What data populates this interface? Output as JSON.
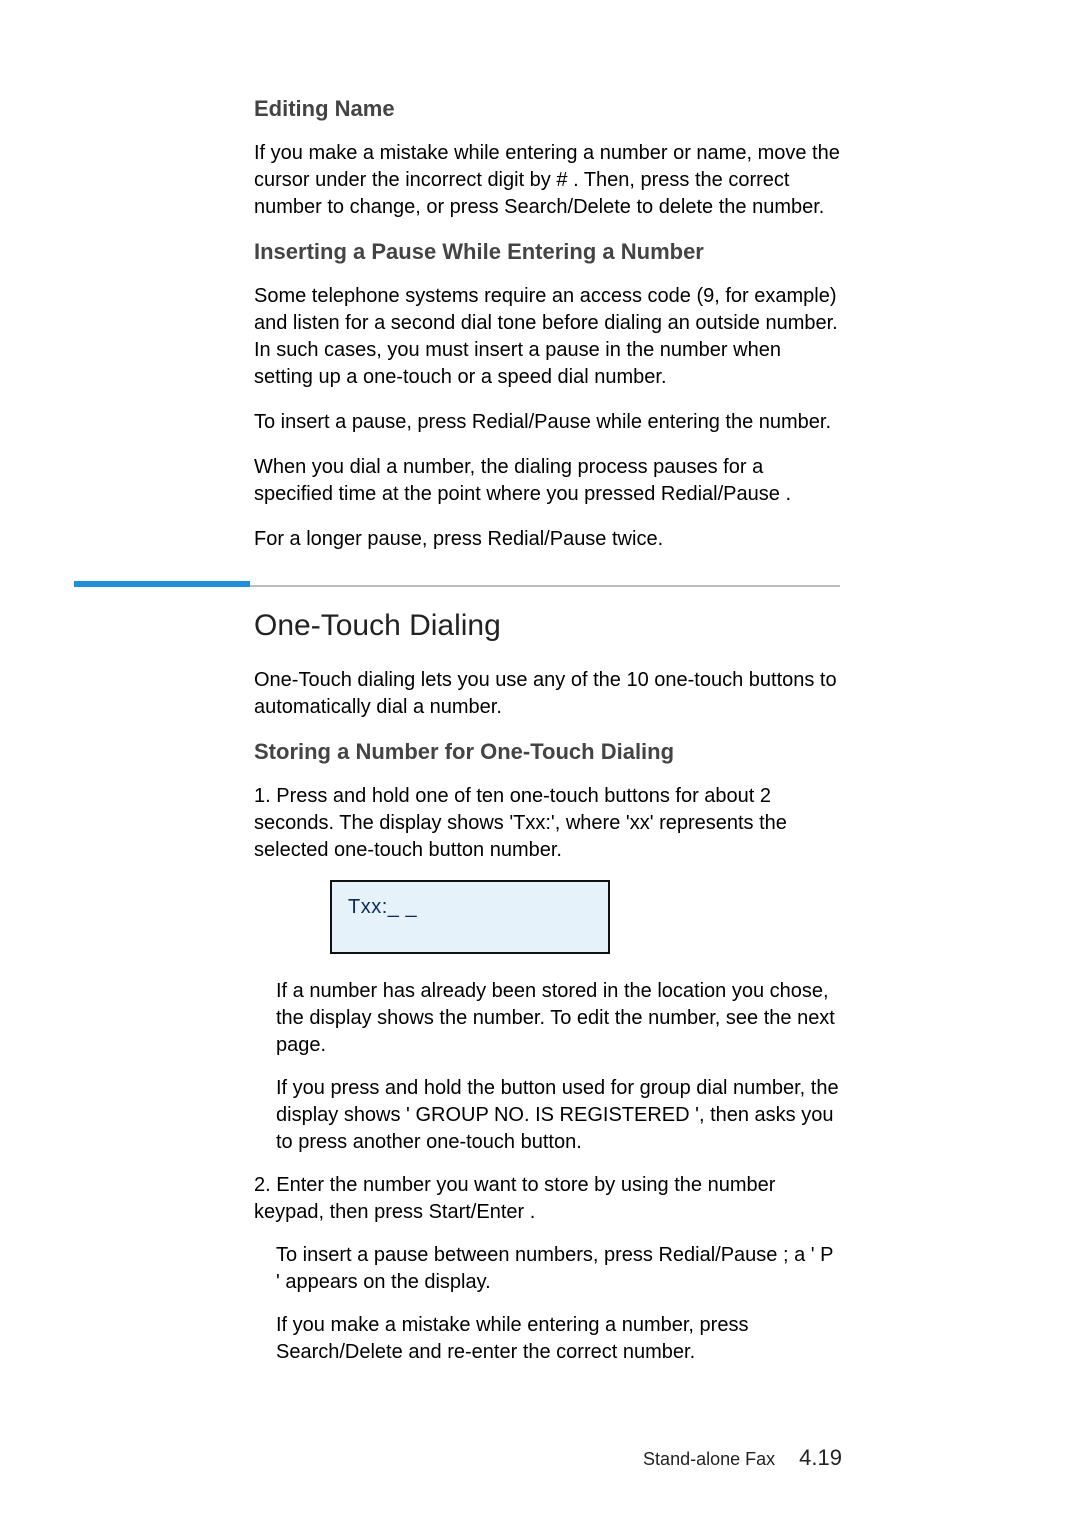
{
  "s1": {
    "title": "Editing Name",
    "p1a": "If you make a mistake while entering a number or name, move the cursor under the incorrect digit by ",
    "p1b": "#",
    "p1c": " . Then, press the correct number to change, or press ",
    "p1d": "Search/Delete",
    "p1e": " to delete the number."
  },
  "s2": {
    "title": "Inserting a Pause While Entering a Number",
    "p1": "Some telephone systems require an access code (9, for example) and listen for a second dial tone before dialing an outside number. In such cases, you must insert a pause in the number when setting up a one-touch or a speed dial number.",
    "p2a": "To insert a pause, press ",
    "p2b": "Redial/Pause",
    "p2c": " while entering the number.",
    "p3a": "When you dial a number, the dialing process pauses for a specified time at the point where you pressed ",
    "p3b": "Redial/Pause",
    "p3c": " .",
    "p4a": "For a longer pause, press ",
    "p4b": "Redial/Pause",
    "p4c": " twice."
  },
  "s3": {
    "title": "One-Touch Dialing",
    "intro": "One-Touch dialing lets you use any of the 10 one-touch buttons to automatically dial a number.",
    "sub": "Storing a Number for One-Touch Dialing",
    "step1": "1. Press and hold one of ten one-touch buttons for about 2 seconds. The display shows 'Txx:', where 'xx' represents the selected one-touch button number.",
    "lcd": "Txx:_ _",
    "step1b": "If a number has already been stored in the location you chose, the display shows the number. To edit the number, see the next page.",
    "step1c_a": "If you press and hold the button used for group dial number, the display shows '",
    "step1c_b": "GROUP NO. IS REGISTERED",
    "step1c_c": "', then asks you to press another one-touch button.",
    "step2a": "2. Enter the number you want to store by using the number keypad, then press ",
    "step2b": "Start/Enter",
    "step2c": " .",
    "step2d_a": "To insert a pause between numbers, press ",
    "step2d_b": "Redial/Pause",
    "step2d_c": " ; a '",
    "step2d_d": "P",
    "step2d_e": "' appears on the display.",
    "step2e_a": "If you make a mistake while entering a number, press ",
    "step2e_b": "Search/Delete",
    "step2e_c": " and re-enter the correct number."
  },
  "footer": {
    "label": "Stand-alone Fax",
    "page": "4.19"
  }
}
